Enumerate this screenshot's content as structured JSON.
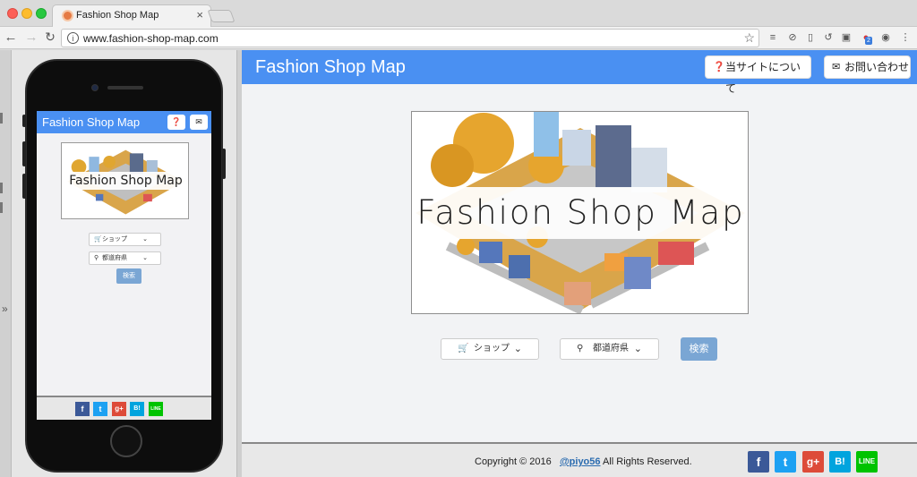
{
  "browser": {
    "tab_title": "Fashion Shop Map",
    "tab_close": "×",
    "url": "www.fashion-shop-map.com",
    "extension_badge": "2"
  },
  "site": {
    "brand": "Fashion Shop Map",
    "nav": {
      "about": "当サイトについて",
      "contact": "お問い合わせ"
    },
    "logo_text": "Fashion Shop Map",
    "shop_select": "ショップ",
    "prefecture_select": "都道府県",
    "search_button": "検索",
    "footer": {
      "copyright": "Copyright © 2016",
      "handle": "@piyo56",
      "rights": "All Rights Reserved."
    },
    "social": [
      {
        "name": "facebook",
        "glyph": "f",
        "color": "#3b5998"
      },
      {
        "name": "twitter",
        "glyph": "t",
        "color": "#1da1f2"
      },
      {
        "name": "google-plus",
        "glyph": "g+",
        "color": "#dd4b39"
      },
      {
        "name": "hatena",
        "glyph": "B!",
        "color": "#00a4de"
      },
      {
        "name": "line",
        "glyph": "LINE",
        "color": "#00c300"
      }
    ]
  },
  "icons": {
    "back": "arrow-left-icon",
    "forward": "arrow-right-icon",
    "reload": "reload-icon",
    "info": "info-icon",
    "star": "star-icon",
    "question": "question-circle-icon",
    "envelope": "envelope-icon",
    "cart": "cart-icon",
    "pin": "map-marker-icon",
    "chevron": "chevron-down-icon"
  },
  "colors": {
    "brand_blue": "#4a90f2",
    "search_button": "#7aa6d4"
  }
}
